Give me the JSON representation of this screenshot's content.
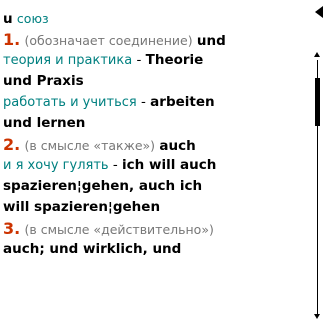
{
  "colors": {
    "teal": "#008080",
    "number": "#cc3300",
    "gray": "#777777"
  },
  "icons": {
    "back": "back-arrow-icon",
    "scroll_up": "scroll-up-icon",
    "scroll_down": "scroll-down-icon"
  },
  "entry": {
    "headword": "u",
    "pos": "союз",
    "senses": [
      {
        "number": "1.",
        "note": "(обозначает соединение)",
        "translation": "und",
        "examples": [
          {
            "ru": "теория и практика",
            "sep": " - ",
            "de_line1": "Theorie",
            "de_line2": "und Praxis"
          },
          {
            "ru": "работать и учиться",
            "sep": " - ",
            "de_line1": "arbeiten",
            "de_line2": "und lernen"
          }
        ]
      },
      {
        "number": "2.",
        "note": "(в смысле «также»)",
        "translation": "auch",
        "examples": [
          {
            "ru": "и я хочу гулять",
            "sep": " - ",
            "de_line1": "ich will auch",
            "de_line2": "spazieren¦gehen, auch ich",
            "de_line3": "will spazieren¦gehen"
          }
        ]
      },
      {
        "number": "3.",
        "note": "(в смысле «действительно»)",
        "translation_line": "auch; und wirklich, und"
      }
    ]
  }
}
